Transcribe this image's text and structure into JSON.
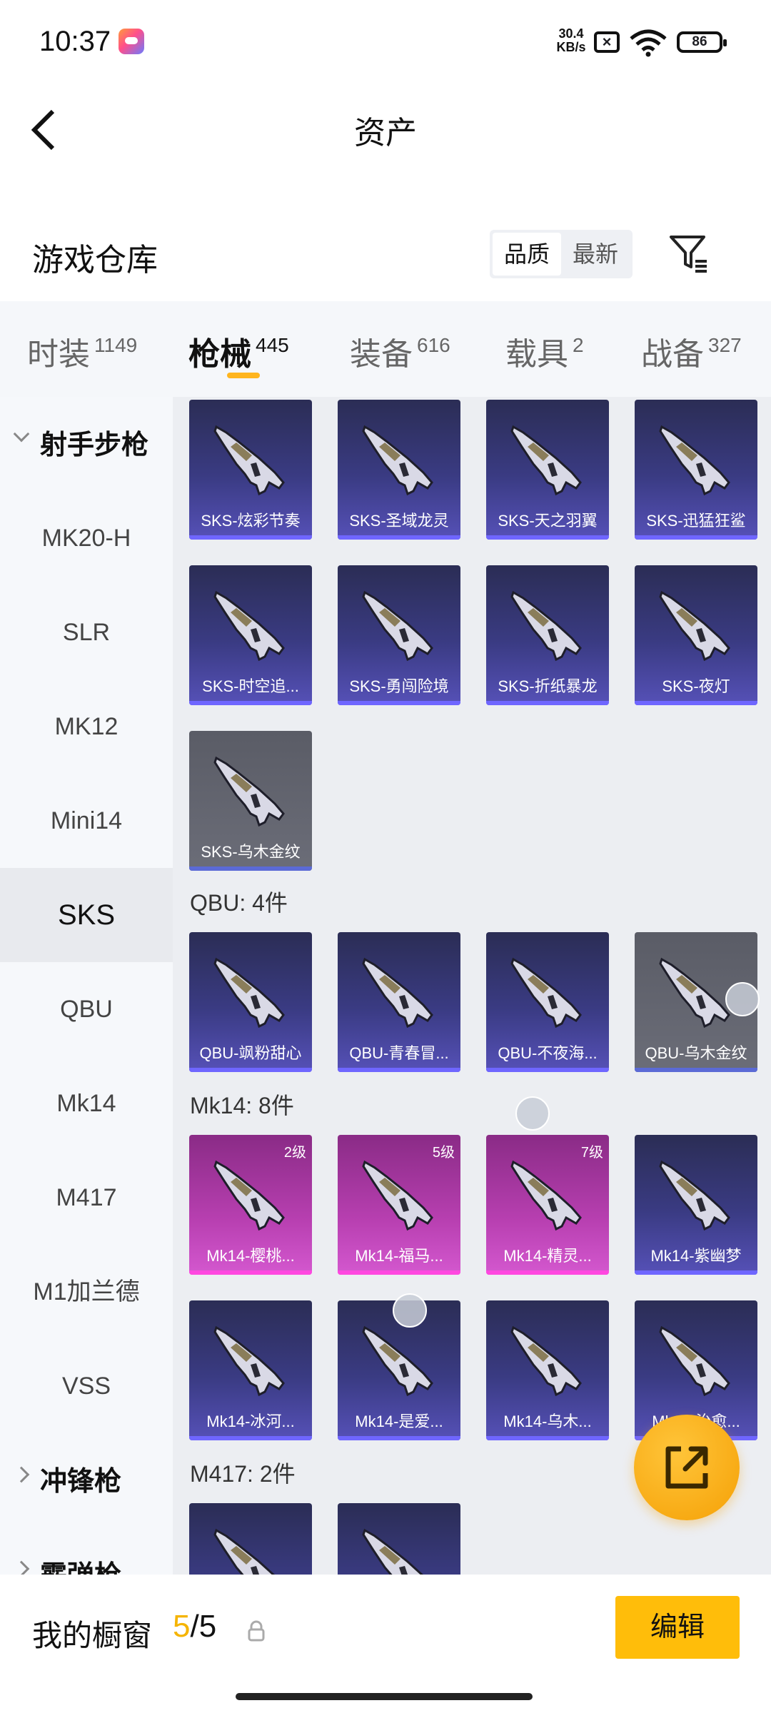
{
  "status_bar": {
    "time": "10:37",
    "net_speed": "30.4 KB/s",
    "battery": "86"
  },
  "header": {
    "title": "资产"
  },
  "warehouse": {
    "title": "游戏仓库",
    "sort_options": [
      "品质",
      "最新"
    ]
  },
  "tabs": [
    {
      "label": "时装",
      "count": "1149"
    },
    {
      "label": "枪械",
      "count": "445"
    },
    {
      "label": "装备",
      "count": "616"
    },
    {
      "label": "载具",
      "count": "2"
    },
    {
      "label": "战备",
      "count": "327"
    }
  ],
  "sidebar": {
    "group_open": "射手步枪",
    "items": [
      "MK20-H",
      "SLR",
      "MK12",
      "Mini14",
      "SKS",
      "QBU",
      "Mk14",
      "M417",
      "M1加兰德",
      "VSS"
    ],
    "group_closed_1": "冲锋枪",
    "group_closed_2": "霰弹枪"
  },
  "content": {
    "sks_items": [
      "SKS-炫彩节奏",
      "SKS-圣域龙灵",
      "SKS-天之羽翼",
      "SKS-迅猛狂鲨",
      "SKS-时空追...",
      "SKS-勇闯险境",
      "SKS-折纸暴龙",
      "SKS-夜灯",
      "SKS-乌木金纹"
    ],
    "qbu_header": "QBU: 4件",
    "qbu_items": [
      "QBU-飒粉甜心",
      "QBU-青春冒...",
      "QBU-不夜海...",
      "QBU-乌木金纹"
    ],
    "mk14_header": "Mk14: 8件",
    "mk14_items": [
      "Mk14-樱桃...",
      "Mk14-福马...",
      "Mk14-精灵...",
      "Mk14-紫幽梦",
      "Mk14-冰河...",
      "Mk14-是爱...",
      "Mk14-乌木...",
      "Mk14-治愈..."
    ],
    "mk14_levels": [
      "2级",
      "5级",
      "7级"
    ],
    "m417_header": "M417: 2件"
  },
  "bottom": {
    "label": "我的橱窗",
    "current": "5",
    "sep_total": "/5",
    "edit": "编辑"
  },
  "colors": {
    "accent": "#ffbd0a",
    "tab_indicator": "#ffb51e",
    "card_purple": "#3a3b83",
    "card_pink": "#b73fb0"
  }
}
